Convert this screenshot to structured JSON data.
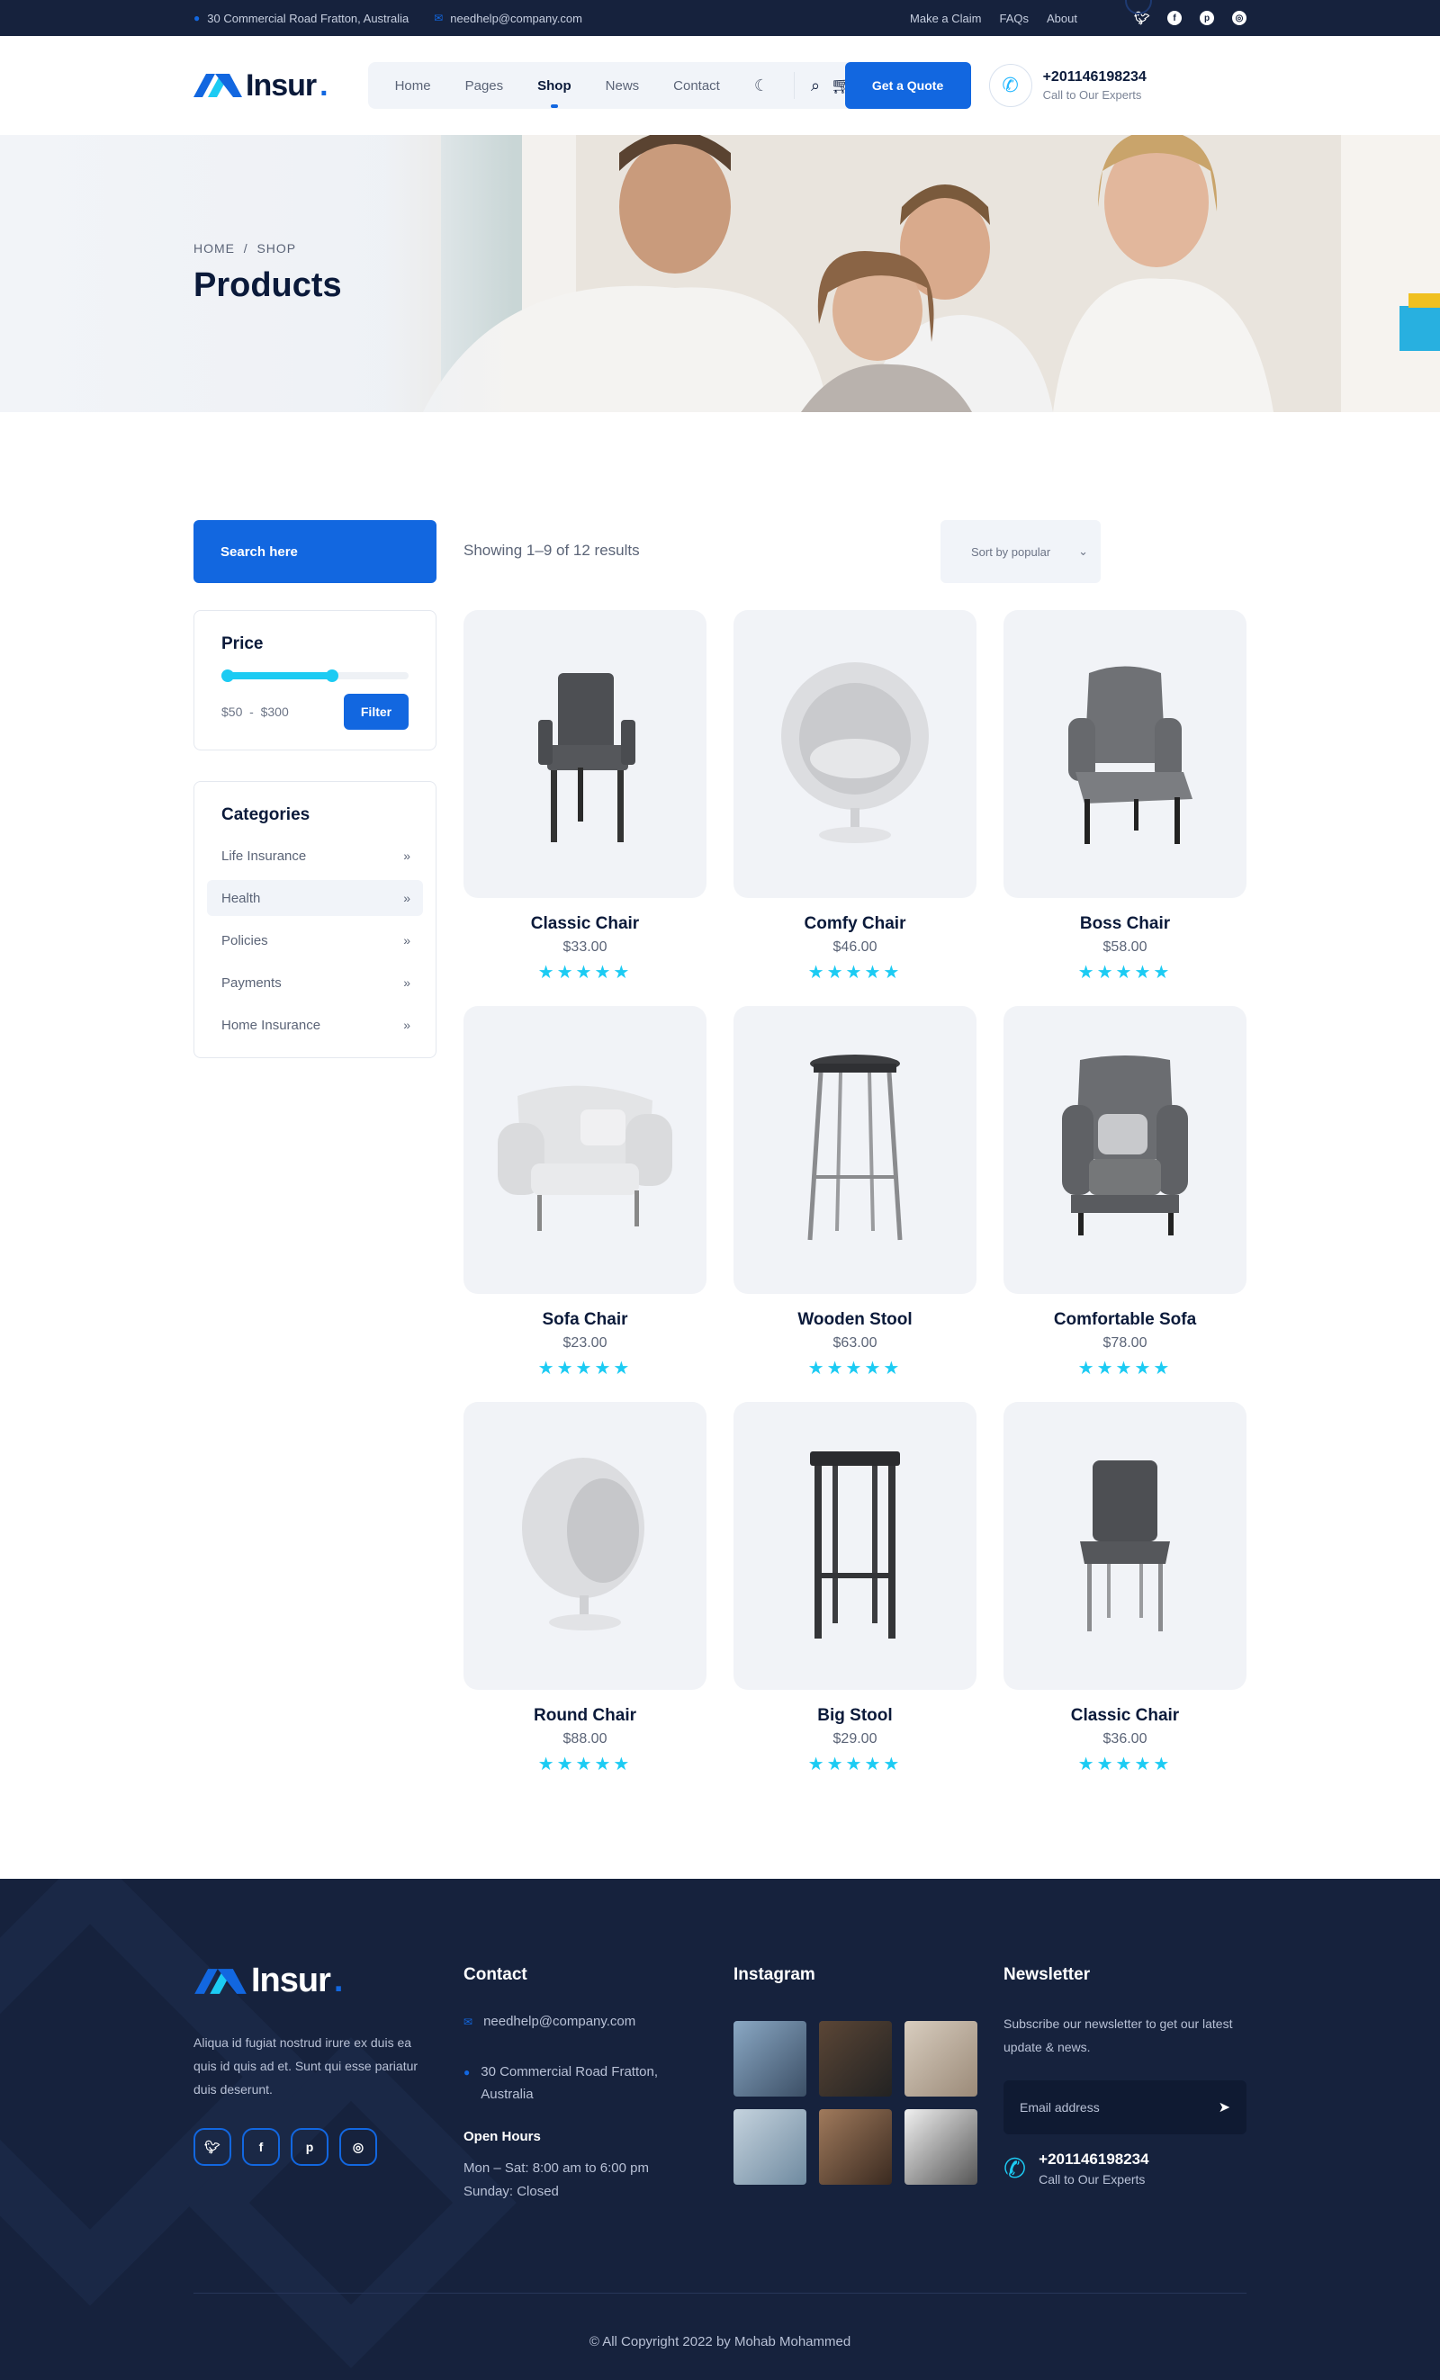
{
  "topbar": {
    "address": "30 Commercial Road Fratton, Australia",
    "email": "needhelp@company.com",
    "links": [
      "Make a Claim",
      "FAQs",
      "About"
    ],
    "social_icons": [
      "twitter-icon",
      "facebook-icon",
      "pinterest-icon",
      "instagram-icon"
    ]
  },
  "header": {
    "logo_text": "Insur",
    "logo_dot": ".",
    "nav": [
      "Home",
      "Pages",
      "Shop",
      "News",
      "Contact"
    ],
    "active_nav": "Shop",
    "quote_button": "Get a Quote",
    "phone": "+201146198234",
    "phone_sub": "Call to Our Experts"
  },
  "hero": {
    "breadcrumb_home": "HOME",
    "breadcrumb_sep": "/",
    "breadcrumb_current": "SHOP",
    "title": "Products"
  },
  "shop": {
    "search_label": "Search here",
    "showing": "Showing 1–9 of 12 results",
    "sort_selected": "Sort by popular",
    "price_title": "Price",
    "price_min": "$50",
    "price_sep": "-",
    "price_max": "$300",
    "filter_button": "Filter",
    "categories_title": "Categories",
    "categories": [
      "Life Insurance",
      "Health",
      "Policies",
      "Payments",
      "Home Insurance"
    ],
    "active_category": "Health",
    "arrow": "»"
  },
  "products": [
    {
      "name": "Classic Chair",
      "price": "$33.00",
      "rating": 5
    },
    {
      "name": "Comfy Chair",
      "price": "$46.00",
      "rating": 5
    },
    {
      "name": "Boss Chair",
      "price": "$58.00",
      "rating": 5
    },
    {
      "name": "Sofa Chair",
      "price": "$23.00",
      "rating": 5
    },
    {
      "name": "Wooden Stool",
      "price": "$63.00",
      "rating": 5
    },
    {
      "name": "Comfortable Sofa",
      "price": "$78.00",
      "rating": 5
    },
    {
      "name": "Round Chair",
      "price": "$88.00",
      "rating": 5
    },
    {
      "name": "Big Stool",
      "price": "$29.00",
      "rating": 5
    },
    {
      "name": "Classic Chair",
      "price": "$36.00",
      "rating": 5
    }
  ],
  "footer": {
    "about": "Aliqua id fugiat nostrud irure ex duis ea quis id quis ad et. Sunt qui esse pariatur duis deserunt.",
    "contact_title": "Contact",
    "email": "needhelp@company.com",
    "address": "30 Commercial Road Fratton, Australia",
    "hours_title": "Open Hours",
    "hours_1": "Mon – Sat: 8:00 am to 6:00 pm",
    "hours_2": "Sunday: Closed",
    "instagram_title": "Instagram",
    "newsletter_title": "Newsletter",
    "newsletter_text": "Subscribe our newsletter to get our latest update & news.",
    "email_placeholder": "Email address",
    "phone": "+201146198234",
    "phone_sub": "Call to Our Experts",
    "copyright": "© All Copyright 2022 by Mohab Mohammed"
  },
  "colors": {
    "primary": "#1267e0",
    "accent": "#1ccbf3",
    "dark": "#16223d"
  }
}
